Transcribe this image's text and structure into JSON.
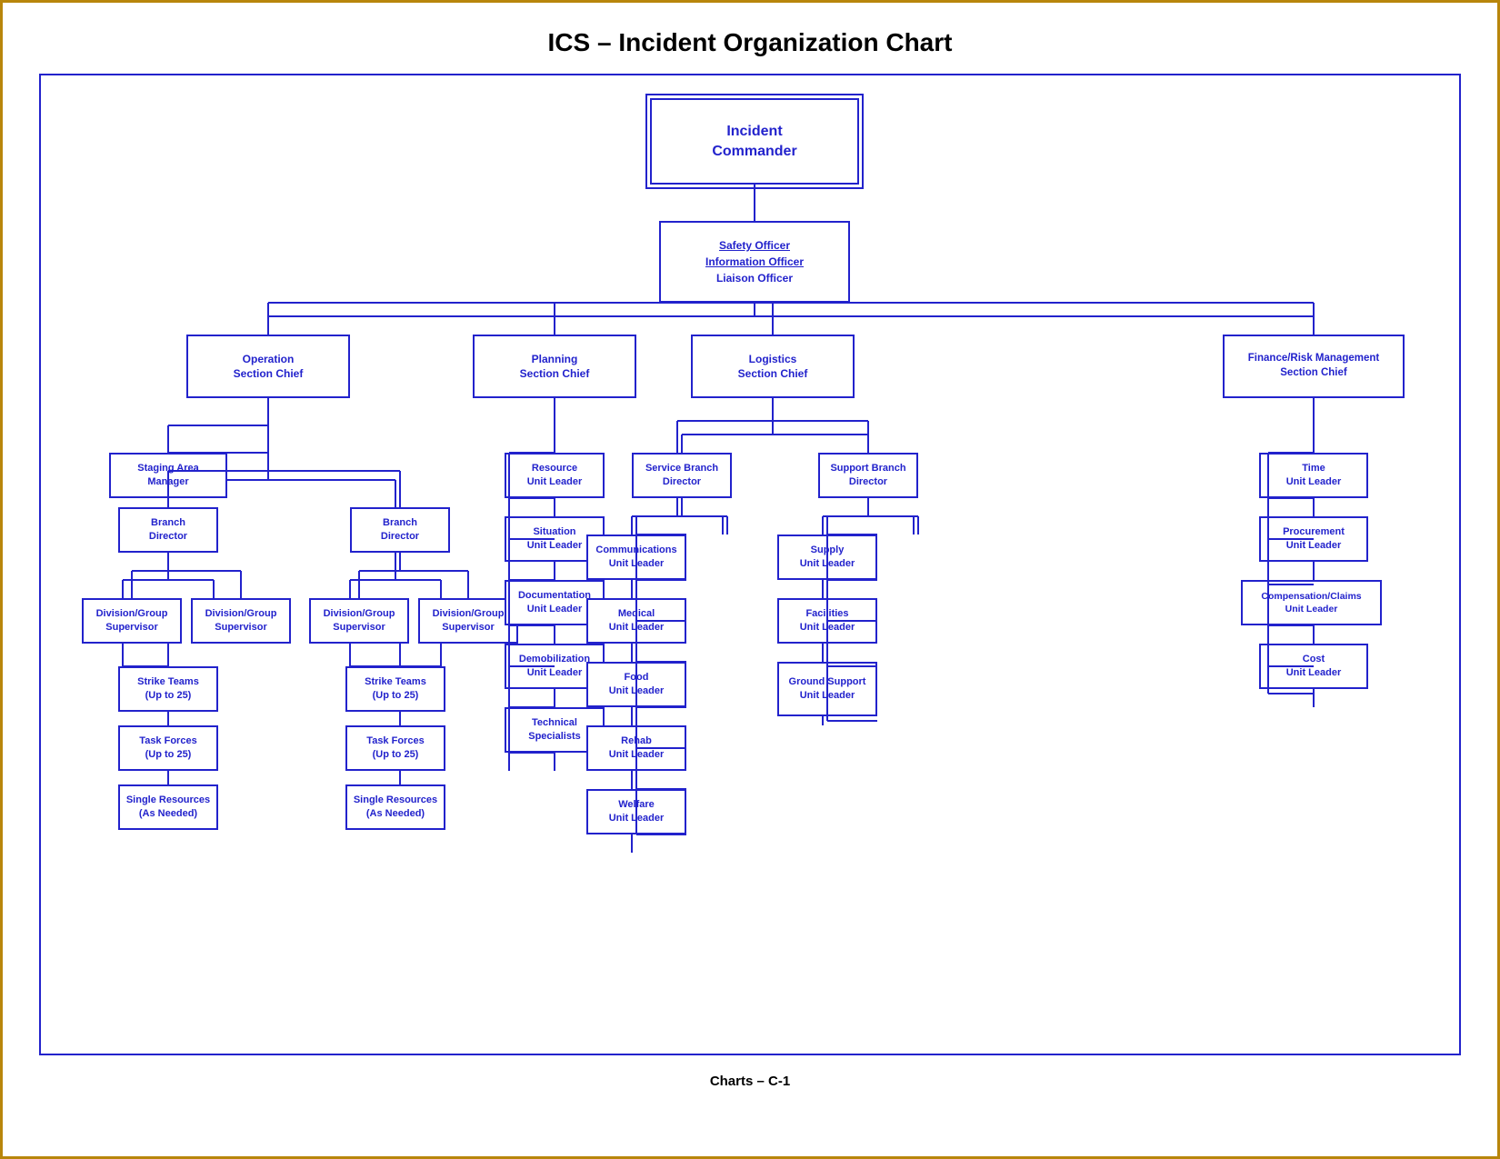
{
  "page": {
    "title": "ICS – Incident Organization Chart",
    "footer": "Charts – C-1",
    "border_color": "#b8860b"
  },
  "nodes": {
    "incident_commander": "Incident\nCommander",
    "safety_officer": "Safety Officer",
    "information_officer": "Information Officer",
    "liaison_officer": "Liaison Officer",
    "operation_section_chief": "Operation\nSection Chief",
    "planning_section_chief": "Planning\nSection Chief",
    "logistics_section_chief": "Logistics\nSection Chief",
    "finance_section_chief": "Finance/Risk Management\nSection Chief",
    "staging_area_manager": "Staging Area\nManager",
    "branch_director_1": "Branch\nDirector",
    "branch_director_2": "Branch\nDirector",
    "div_group_sup_1a": "Division/Group\nSupervisor",
    "div_group_sup_1b": "Division/Group\nSupervisor",
    "div_group_sup_2a": "Division/Group\nSupervisor",
    "div_group_sup_2b": "Division/Group\nSupervisor",
    "strike_teams_1": "Strike Teams\n(Up to 25)",
    "strike_teams_2": "Strike Teams\n(Up to 25)",
    "task_forces_1": "Task Forces\n(Up to 25)",
    "task_forces_2": "Task Forces\n(Up to 25)",
    "single_resources_1": "Single Resources\n(As Needed)",
    "single_resources_2": "Single Resources\n(As Needed)",
    "resource_unit_leader": "Resource\nUnit Leader",
    "situation_unit_leader": "Situation\nUnit Leader",
    "documentation_unit_leader": "Documentation\nUnit Leader",
    "demobilization_unit_leader": "Demobilization\nUnit Leader",
    "technical_specialists": "Technical\nSpecialists",
    "service_branch_director": "Service Branch\nDirector",
    "support_branch_director": "Support Branch\nDirector",
    "communications_unit_leader": "Communications\nUnit Leader",
    "medical_unit_leader": "Medical\nUnit Leader",
    "food_unit_leader": "Food\nUnit Leader",
    "rehab_unit_leader": "Rehab\nUnit Leader",
    "welfare_unit_leader": "Welfare\nUnit Leader",
    "supply_unit_leader": "Supply\nUnit Leader",
    "facilities_unit_leader": "Facilities\nUnit Leader",
    "ground_support_unit_leader": "Ground Support\nUnit Leader",
    "time_unit_leader": "Time\nUnit Leader",
    "procurement_unit_leader": "Procurement\nUnit Leader",
    "compensation_claims_unit_leader": "Compensation/Claims\nUnit Leader",
    "cost_unit_leader": "Cost\nUnit Leader"
  }
}
